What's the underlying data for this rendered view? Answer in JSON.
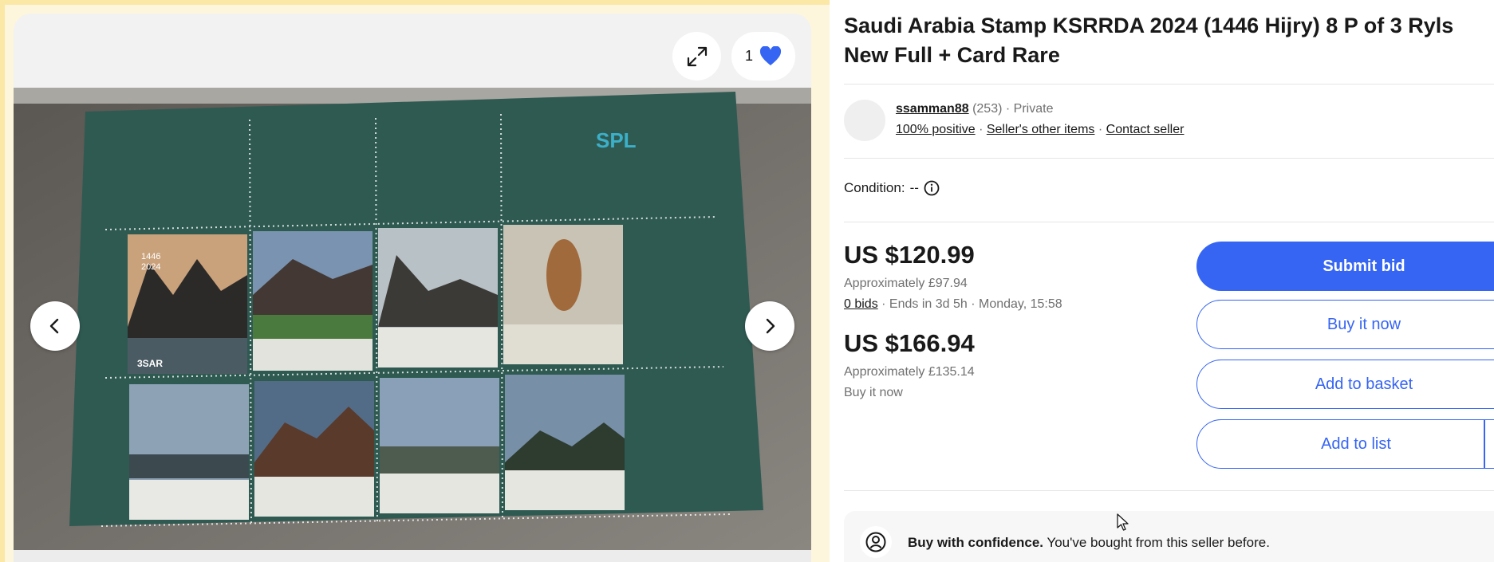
{
  "gallery": {
    "watch_count": "1",
    "icons": {
      "expand": "expand-icon",
      "watch": "heart-icon",
      "prev": "chevron-left-icon",
      "next": "chevron-right-icon"
    },
    "photo_labels": {
      "year_hijri": "1446",
      "year": "2024",
      "brand": "SPL",
      "value": "3SAR"
    }
  },
  "listing": {
    "title": "Saudi Arabia Stamp KSRRDA 2024 (1446 Hijry) 8 P of 3 Ryls New Full + Card Rare",
    "seller": {
      "name": "ssamman88",
      "feedback_count": "(253)",
      "type": "Private",
      "positive": "100% positive",
      "other_items": "Seller's other items",
      "contact": "Contact seller",
      "separator": "·"
    },
    "condition": {
      "label": "Condition:",
      "value": "--"
    },
    "auction": {
      "price": "US $120.99",
      "approx": "Approximately £97.94",
      "bids": "0 bids",
      "ends": "· Ends in 3d 5h · Monday, 15:58"
    },
    "buy_now": {
      "price": "US $166.94",
      "approx": "Approximately £135.14",
      "label": "Buy it now"
    },
    "buttons": {
      "submit_bid": "Submit bid",
      "buy_it_now": "Buy it now",
      "add_to_basket": "Add to basket",
      "add_to_list": "Add to list"
    },
    "confidence": {
      "bold": "Buy with confidence.",
      "text": " You've bought from this seller before."
    }
  },
  "colors": {
    "accent": "#3665f3",
    "stamp_sheet": "#2f5a52"
  }
}
